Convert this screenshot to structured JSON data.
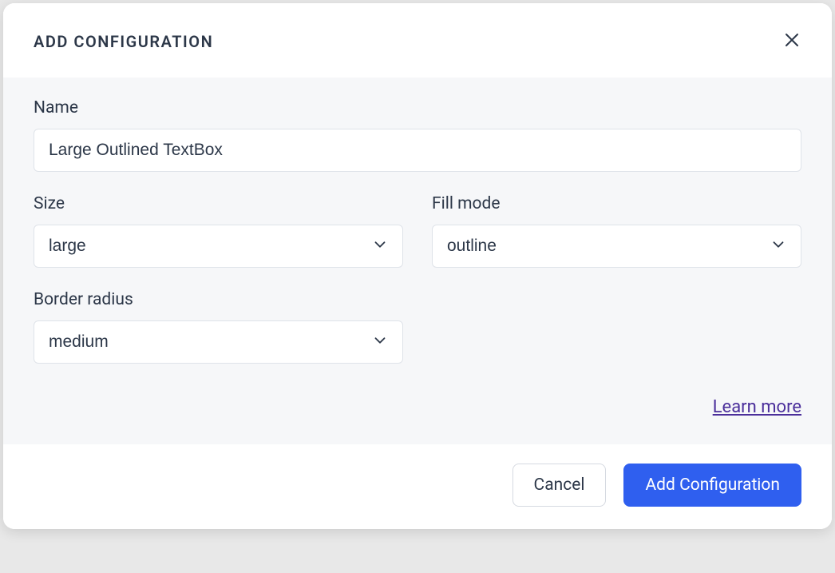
{
  "header": {
    "title": "ADD CONFIGURATION"
  },
  "fields": {
    "name": {
      "label": "Name",
      "value": "Large Outlined TextBox"
    },
    "size": {
      "label": "Size",
      "value": "large"
    },
    "fillMode": {
      "label": "Fill mode",
      "value": "outline"
    },
    "borderRadius": {
      "label": "Border radius",
      "value": "medium"
    }
  },
  "links": {
    "learnMore": "Learn more"
  },
  "footer": {
    "cancel": "Cancel",
    "submit": "Add Configuration"
  }
}
